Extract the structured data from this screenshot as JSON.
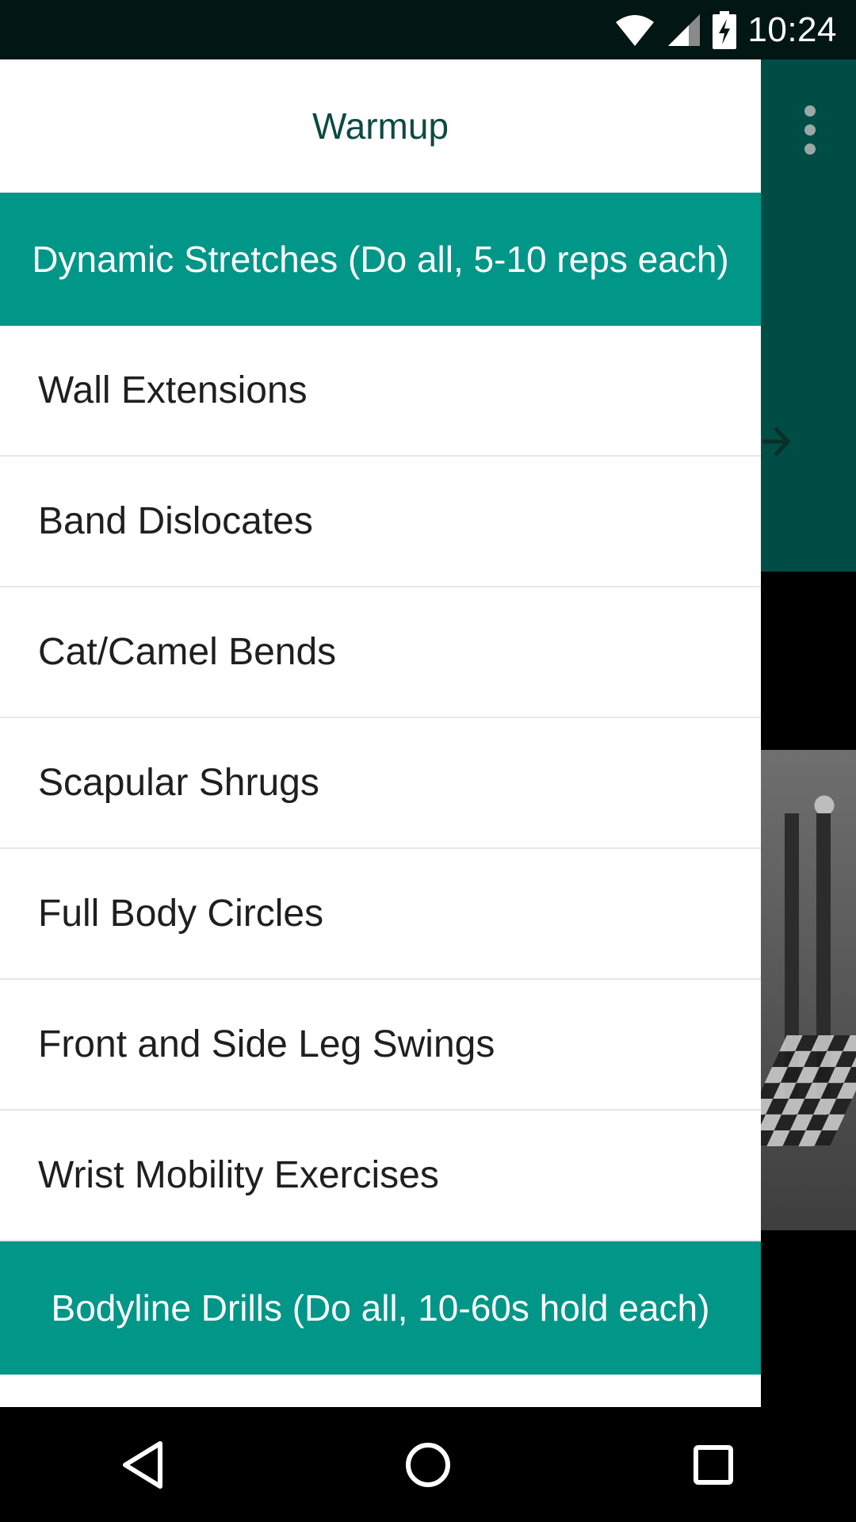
{
  "status_bar": {
    "time": "10:24",
    "icons": [
      "wifi-icon",
      "cell-signal-icon",
      "battery-charging-icon"
    ]
  },
  "drawer": {
    "title": "Warmup",
    "sections": [
      {
        "header": "Dynamic Stretches (Do all, 5-10 reps each)",
        "items": [
          "Wall Extensions",
          "Band Dislocates",
          "Cat/Camel Bends",
          "Scapular Shrugs",
          "Full Body Circles",
          "Front and Side Leg Swings",
          "Wrist Mobility Exercises"
        ]
      },
      {
        "header": "Bodyline Drills (Do all, 10-60s hold each)",
        "items": []
      }
    ]
  },
  "background": {
    "icons": [
      "overflow-menu-icon",
      "arrow-right-icon"
    ],
    "colors": {
      "toolbar": "#004d45",
      "accent": "#009688"
    }
  },
  "nav_bar": {
    "icons": [
      "back-icon",
      "home-icon",
      "recents-icon"
    ]
  }
}
